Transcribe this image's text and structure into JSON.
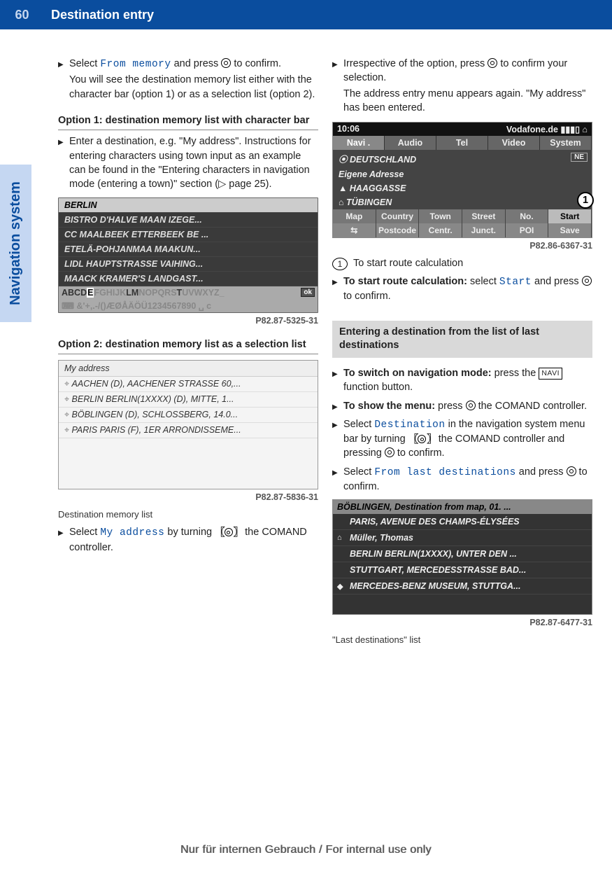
{
  "page_number": "60",
  "page_title": "Destination entry",
  "side_tab": "Navigation system",
  "left": {
    "step1_a": "Select ",
    "step1_mono": "From memory",
    "step1_b": " and press ",
    "step1_c": " to confirm.",
    "step1_body": "You will see the destination memory list either with the character bar (option 1) or as a selection list (option 2).",
    "h_opt1": "Option 1: destination memory list with character bar",
    "step2": "Enter a destination, e.g. \"My address\". Instructions for entering characters using town input as an example can be found in the \"Entering characters in navigation mode (entering a town)\" section (▷ page 25).",
    "shot1": {
      "hdr": "BERLIN",
      "rows": [
        "BISTRO D'HALVE MAAN IZEGE...",
        "CC MAALBEEK ETTERBEEK BE ...",
        "ETELÄ-POHJANMAA MAAKUN...",
        "LIDL HAUPTSTRASSE VAIHING...",
        "MAACK KRAMER'S LANDGAST..."
      ],
      "charbar1_a": "ABCD",
      "charbar1_e": "E",
      "charbar1_b": "FGHIJK",
      "charbar1_lm": "LM",
      "charbar1_c": "NOPQRS",
      "charbar1_t": "T",
      "charbar1_d": "UVWXYZ_",
      "charbar1_ok": "ok",
      "charbar2": "⌨ &'+,.-/()ÆØÅÄÖÜ1234567890 ␣ c",
      "id": "P82.87-5325-31"
    },
    "h_opt2": "Option 2: destination memory list as a selection list",
    "shot2": {
      "hdr": "My address",
      "rows": [
        "AACHEN (D), AACHENER STRASSE 60,...",
        "BERLIN BERLIN(1XXXX) (D), MITTE, 1...",
        "BÖBLINGEN (D), SCHLOSSBERG, 14.0...",
        "PARIS PARIS (F), 1ER ARRONDISSEME..."
      ],
      "id": "P82.87-5836-31"
    },
    "caption2": "Destination memory list",
    "step3_a": "Select ",
    "step3_mono": "My address",
    "step3_b": " by turning ",
    "step3_c": " the COMAND controller."
  },
  "right": {
    "step1_a": "Irrespective of the option, press ",
    "step1_b": " to confirm your selection.",
    "step1_body": "The address entry menu appears again. \"My address\" has been entered.",
    "shot3": {
      "status_l": "10:06",
      "status_r": "Vodafone.de ▮▮▮▯ ⌂",
      "tabs": [
        "Navi .",
        "Audio",
        "Tel",
        "Video",
        "System"
      ],
      "rows": [
        "⦿ DEUTSCHLAND",
        "   Eigene Adresse",
        "▲ HAAGGASSE",
        "⌂ TÜBINGEN"
      ],
      "compass": "NE",
      "bot1": [
        "Map",
        "Country",
        "Town",
        "Street",
        "No.",
        "Start"
      ],
      "bot2": [
        "⇆",
        "Postcode",
        "Centr.",
        "Junct.",
        "POI",
        "Save"
      ],
      "marker": "1",
      "id": "P82.86-6367-31"
    },
    "legend1_num": "1",
    "legend1_txt": "To start route calculation",
    "step2_a": "To start route calculation:",
    "step2_b": " select ",
    "step2_mono": "Start",
    "step2_c": " and press ",
    "step2_d": " to confirm.",
    "sect_head": "Entering a destination from the list of last destinations",
    "step3_a": "To switch on navigation mode:",
    "step3_b": " press the ",
    "step3_navi": "NAVI",
    "step3_c": " function button.",
    "step4_a": "To show the menu:",
    "step4_b": " press ",
    "step4_c": " the COMAND controller.",
    "step5_a": "Select ",
    "step5_mono": "Destination",
    "step5_b": " in the navigation system menu bar by turning ",
    "step5_c": " the COMAND controller and pressing ",
    "step5_d": " to confirm.",
    "step6_a": "Select ",
    "step6_mono": "From last destinations",
    "step6_b": " and press ",
    "step6_c": " to confirm.",
    "shot4": {
      "hdr": "BÖBLINGEN, Destination from map, 01. ...",
      "rows": [
        {
          "ico": "",
          "txt": "PARIS, AVENUE DES CHAMPS-ÉLYSÉES"
        },
        {
          "ico": "⌂",
          "txt": "Müller, Thomas"
        },
        {
          "ico": "",
          "txt": "BERLIN BERLIN(1XXXX), UNTER DEN ..."
        },
        {
          "ico": "",
          "txt": "STUTTGART, MERCEDESSTRASSE BAD..."
        },
        {
          "ico": "◆",
          "txt": "MERCEDES-BENZ MUSEUM, STUTTGA..."
        }
      ],
      "id": "P82.87-6477-31"
    },
    "caption4": "\"Last destinations\" list"
  },
  "watermark": "Nur für internen Gebrauch / For internal use only"
}
